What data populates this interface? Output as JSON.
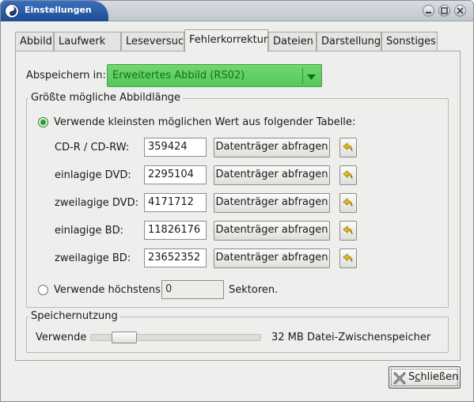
{
  "window": {
    "title": "Einstellungen"
  },
  "tabs": [
    "Abbild",
    "Laufwerk",
    "Leseversuche",
    "Fehlerkorrektur",
    "Dateien",
    "Darstellung",
    "Sonstiges"
  ],
  "active_tab": "Fehlerkorrektur",
  "save_in": {
    "label": "Abspeichern in:",
    "value": "Erweitertes Abbild (RS02)"
  },
  "size_frame": {
    "title": "Größte mögliche Abbildlänge",
    "option_table_label": "Verwende kleinsten möglichen Wert aus folgender Tabelle:",
    "rows": [
      {
        "label": "CD-R / CD-RW:",
        "value": "359424",
        "button": "Datenträger abfragen"
      },
      {
        "label": "einlagige DVD:",
        "value": "2295104",
        "button": "Datenträger abfragen"
      },
      {
        "label": "zweilagige DVD:",
        "value": "4171712",
        "button": "Datenträger abfragen"
      },
      {
        "label": "einlagige BD:",
        "value": "11826176",
        "button": "Datenträger abfragen"
      },
      {
        "label": "zweilagige BD:",
        "value": "23652352",
        "button": "Datenträger abfragen"
      }
    ],
    "option_max_label": "Verwende höchstens",
    "option_max_value": "0",
    "option_max_unit": "Sektoren."
  },
  "memory_frame": {
    "title": "Speichernutzung",
    "use_label": "Verwende",
    "value_text": "32 MB Datei-Zwischenspeicher"
  },
  "close_button": {
    "prefix": "S",
    "underlined": "c",
    "suffix": "hließen"
  },
  "icons": {
    "app": "app-logo-icon",
    "minimize": "minimize-icon",
    "maximize": "maximize-icon",
    "close": "close-icon",
    "undo": "undo-arrow-icon",
    "close_x": "close-x-icon"
  },
  "colors": {
    "combo_bg": "#5fd062",
    "combo_text": "#13701a",
    "radio_checked": "#2a9d2a",
    "titlebar_active": "#2a5ca8"
  }
}
